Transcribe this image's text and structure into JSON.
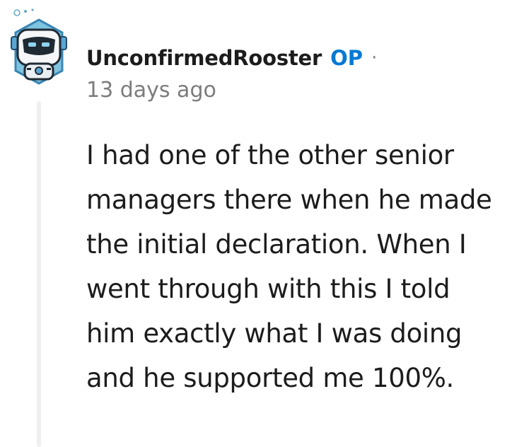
{
  "comment": {
    "username": "UnconfirmedRooster",
    "op_badge": "OP",
    "separator": "·",
    "timestamp": "13 days ago",
    "body": "I had one of the other senior managers there when he made the initial declaration. When I went through with this I told him exactly what I was doing and he supported me 100%.",
    "avatar_icon": "robot-avatar-icon"
  },
  "colors": {
    "op_accent": "#0079d3",
    "meta_gray": "#7c7c7c",
    "text": "#1c1c1c",
    "thread_line": "#edeff1"
  }
}
